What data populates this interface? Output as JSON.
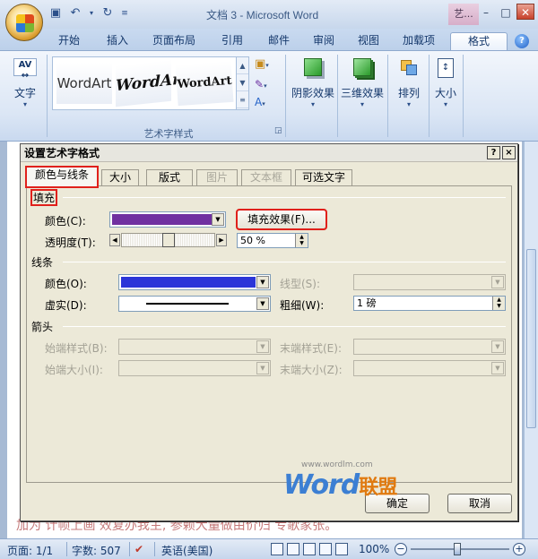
{
  "window": {
    "title": "文档 3 - Microsoft Word",
    "context_tab": "艺..."
  },
  "ribbon": {
    "tabs": [
      "开始",
      "插入",
      "页面布局",
      "引用",
      "邮件",
      "审阅",
      "视图",
      "加载项",
      "格式"
    ],
    "active_tab": "格式",
    "text_button": "文字",
    "wordart_samples": [
      "WordArt",
      "WordArt",
      "WordArt"
    ],
    "wordart_group_label": "艺术字样式",
    "shadow_effects": "阴影效果",
    "3d_effects": "三维效果",
    "arrange": "排列",
    "size": "大小"
  },
  "dialog": {
    "title": "设置艺术字格式",
    "help_btn": "?",
    "close_btn": "×",
    "tabs": [
      {
        "label": "颜色与线条",
        "active": true,
        "disabled": false
      },
      {
        "label": "大小",
        "active": false,
        "disabled": false
      },
      {
        "label": "版式",
        "active": false,
        "disabled": false
      },
      {
        "label": "图片",
        "active": false,
        "disabled": true
      },
      {
        "label": "文本框",
        "active": false,
        "disabled": true
      },
      {
        "label": "可选文字",
        "active": false,
        "disabled": false
      }
    ],
    "fill": {
      "section": "填充",
      "color_label": "颜色(C):",
      "color_value": "#7030a0",
      "fill_effects_button": "填充效果(F)...",
      "transparency_label": "透明度(T):",
      "transparency_value": "50 %",
      "transparency_level": 0.5
    },
    "line": {
      "section": "线条",
      "color_label": "颜色(O):",
      "color_value": "#2b35d8",
      "style_label": "线型(S):",
      "dash_label": "虚实(D):",
      "weight_label": "粗细(W):",
      "weight_value": "1 磅"
    },
    "arrows": {
      "section": "箭头",
      "begin_style": "始端样式(B):",
      "end_style": "末端样式(E):",
      "begin_size": "始端大小(I):",
      "end_size": "末端大小(Z):"
    },
    "ok_button": "确定",
    "cancel_button": "取消"
  },
  "watermark": {
    "url": "www.wordlm.com",
    "brand": "Word",
    "brand_suffix": "联盟"
  },
  "document": {
    "visible_text": "加为 计帧上画 效复办我主, 参赖大量做由价归 专歌家张。"
  },
  "statusbar": {
    "page": "页面: 1/1",
    "words": "字数: 507",
    "language": "英语(美国)",
    "zoom": "100%",
    "zoom_level": 1.0
  },
  "colors": {
    "highlight_red": "#e0201b",
    "fill_purple": "#7030a0",
    "line_blue": "#2b35d8"
  }
}
